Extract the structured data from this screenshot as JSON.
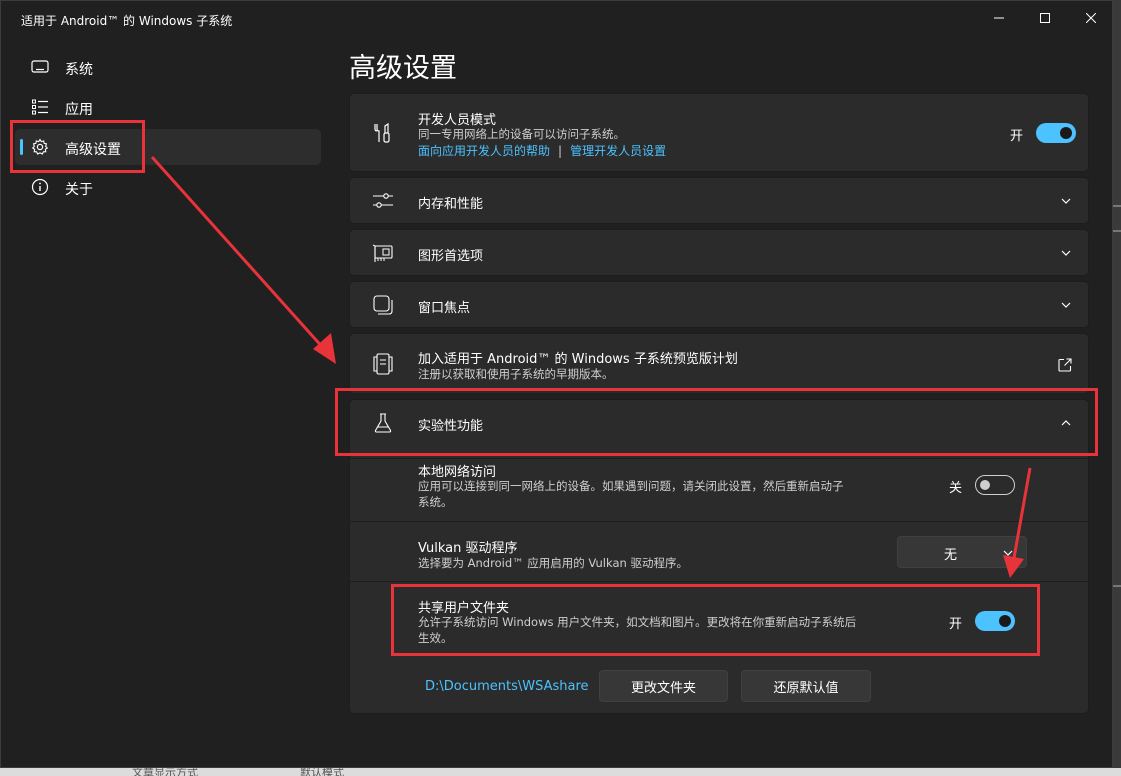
{
  "window": {
    "title": "适用于 Android™ 的 Windows 子系统"
  },
  "nav": {
    "items": [
      {
        "label": "系统",
        "icon": "monitor-icon"
      },
      {
        "label": "应用",
        "icon": "list-icon"
      },
      {
        "label": "高级设置",
        "icon": "gear-icon",
        "active": true
      },
      {
        "label": "关于",
        "icon": "info-icon"
      }
    ]
  },
  "page": {
    "title": "高级设置"
  },
  "developer_mode": {
    "title": "开发人员模式",
    "desc": "同一专用网络上的设备可以访问子系统。",
    "link1": "面向应用开发人员的帮助",
    "separator": "|",
    "link2": "管理开发人员设置",
    "toggle_label": "开",
    "toggle_on": true
  },
  "memory": {
    "title": "内存和性能"
  },
  "graphics": {
    "title": "图形首选项"
  },
  "focus": {
    "title": "窗口焦点"
  },
  "preview": {
    "title": "加入适用于 Android™ 的 Windows 子系统预览版计划",
    "desc": "注册以获取和使用子系统的早期版本。"
  },
  "experimental": {
    "title": "实验性功能",
    "local_network": {
      "title": "本地网络访问",
      "desc_line1": "应用可以连接到同一网络上的设备。如果遇到问题，请关闭此设置，然后重新启动子",
      "desc_line2": "系统。",
      "toggle_label": "关",
      "toggle_on": false
    },
    "vulkan": {
      "title": "Vulkan 驱动程序",
      "desc": "选择要为 Android™ 应用启用的 Vulkan 驱动程序。",
      "selected": "无"
    },
    "shared_folder": {
      "title": "共享用户文件夹",
      "desc_line1": "允许子系统访问 Windows 用户文件夹，如文档和图片。更改将在你重新启动子系统后",
      "desc_line2": "生效。",
      "toggle_label": "开",
      "toggle_on": true,
      "path": "D:\\Documents\\WSAshare",
      "change_button": "更改文件夹",
      "reset_button": "还原默认值"
    }
  },
  "background": {
    "text1": "文章显示方式",
    "text2": "默认模式"
  },
  "colors": {
    "accent": "#4cc2ff",
    "highlight": "#e8333a",
    "card": "#2b2b2b",
    "window": "#202020"
  }
}
